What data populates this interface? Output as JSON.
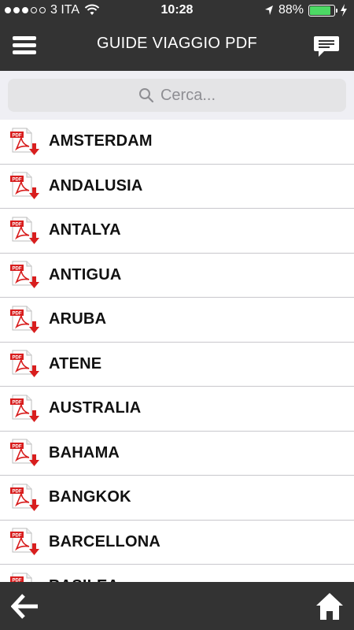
{
  "status_bar": {
    "carrier": "3 ITA",
    "time": "10:28",
    "battery_percent": "88%",
    "battery_level": 0.88,
    "signal_bars_on": 3,
    "signal_bars_total": 5,
    "icons": [
      "wifi-icon",
      "location-arrow-icon",
      "battery-icon",
      "charging-bolt-icon"
    ]
  },
  "navbar": {
    "title": "GUIDE VIAGGIO PDF",
    "left_icon": "hamburger-menu-icon",
    "right_icon": "chat-bubble-icon"
  },
  "search": {
    "placeholder": "Cerca...",
    "icon": "search-icon"
  },
  "list": {
    "item_icon": "pdf-download-icon",
    "items": [
      {
        "label": "AMSTERDAM"
      },
      {
        "label": "ANDALUSIA"
      },
      {
        "label": "ANTALYA"
      },
      {
        "label": "ANTIGUA"
      },
      {
        "label": "ARUBA"
      },
      {
        "label": "ATENE"
      },
      {
        "label": "AUSTRALIA"
      },
      {
        "label": "BAHAMA"
      },
      {
        "label": "BANGKOK"
      },
      {
        "label": "BARCELLONA"
      },
      {
        "label": "BASILEA"
      }
    ]
  },
  "footer": {
    "left_icon": "back-arrow-icon",
    "right_icon": "home-icon"
  },
  "colors": {
    "bar_background": "#333333",
    "pdf_red": "#d81e1e",
    "battery_green": "#4cd964",
    "search_background": "#e4e4e6"
  }
}
